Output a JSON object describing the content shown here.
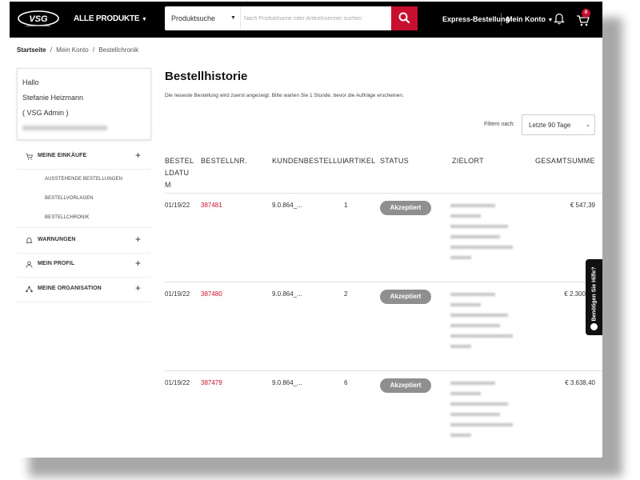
{
  "header": {
    "logo_text": "VSG",
    "all_products": "ALLE PRODUKTE",
    "search_category": "Produktsuche",
    "search_placeholder": "Nach Produktname oder Artikelnummer suchen",
    "express_order": "Express-Bestellung",
    "my_account": "Mein Konto",
    "cart_count": "0"
  },
  "breadcrumb": {
    "home": "Startseite",
    "account": "Mein Konto",
    "current": "Bestellchronik",
    "separator": "/"
  },
  "user": {
    "greeting": "Hallo",
    "name": "Stefanie Heizmann",
    "role": "( VSG Admin )"
  },
  "sidebar": {
    "purchases": "MEINE EINKÄUFE",
    "purchases_sub": [
      "AUSSTEHENDE BESTELLUNGEN",
      "BESTELLVORLAGEN",
      "BESTELLCHRONIK"
    ],
    "warnings": "WARNUNGEN",
    "profile": "MEIN PROFIL",
    "organisation": "MEINE ORGANISATION"
  },
  "main": {
    "title": "Bestellhistorie",
    "info": "Die neueste Bestellung wird zuerst angezeigt. Bitte warten Sie 1 Stunde, bevor die Aufträge erscheinen.",
    "filter_label": "Filtern nach:",
    "filter_value": "Letzte 90 Tage"
  },
  "table": {
    "columns": [
      "BESTEL LDATU M",
      "BESTELLNR.",
      "KUNDENBESTELLUI",
      "ARTIKEL",
      "STATUS",
      "ZIELORT",
      "GESAMTSUMME"
    ],
    "rows": [
      {
        "date": "01/19/22",
        "order_no": "387481",
        "customer_order": "9.0.864_...",
        "items": "1",
        "status": "Akzeptiert",
        "total": "€ 547,39"
      },
      {
        "date": "01/19/22",
        "order_no": "387480",
        "customer_order": "9.0.864_...",
        "items": "2",
        "status": "Akzeptiert",
        "total": "€ 2.300"
      },
      {
        "date": "01/19/22",
        "order_no": "387479",
        "customer_order": "9.0.864_...",
        "items": "6",
        "status": "Akzeptiert",
        "total": "€ 3.638,40"
      }
    ]
  },
  "help_tab": "Benötigen Sie Hilfe?"
}
